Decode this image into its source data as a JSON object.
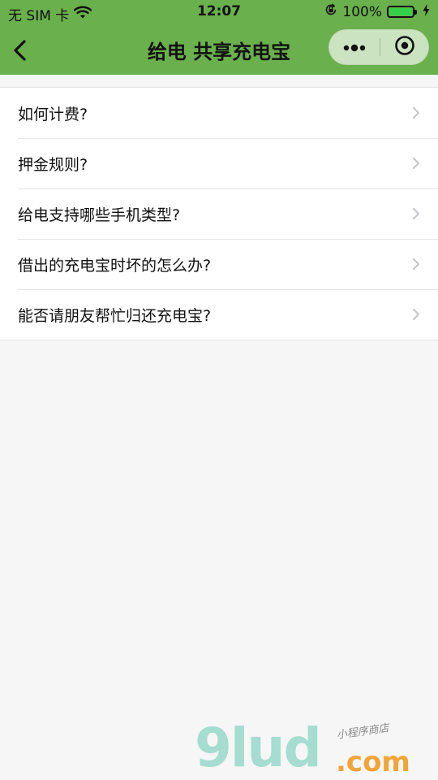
{
  "status_bar": {
    "carrier": "无 SIM 卡",
    "time": "12:07",
    "battery_percent": "100%",
    "battery_level": 1.0,
    "icons": [
      "wifi-icon",
      "rotation-lock-icon",
      "battery-icon",
      "charging-icon"
    ]
  },
  "nav": {
    "title": "给电 共享充电宝",
    "back_icon": "chevron-left-icon",
    "more_icon": "more-dots-icon",
    "close_icon": "target-close-icon"
  },
  "faq": {
    "items": [
      {
        "label": "如何计费?"
      },
      {
        "label": "押金规则?"
      },
      {
        "label": "给电支持哪些手机类型?"
      },
      {
        "label": "借出的充电宝时坏的怎么办?"
      },
      {
        "label": "能否请朋友帮忙归还充电宝?"
      }
    ]
  },
  "watermark": {
    "logo": "9lud",
    "domain": ".com",
    "tagline": "小程序商店"
  },
  "colors": {
    "header": "#6ab04c",
    "background": "#f6f6f6",
    "list_bg": "#ffffff",
    "divider": "#e5e5e5",
    "text": "#111111",
    "chevron": "#c7c7cc",
    "battery_fill": "#35d04a",
    "watermark_logo": "#a5ddd0",
    "watermark_domain": "#f0a43a"
  }
}
